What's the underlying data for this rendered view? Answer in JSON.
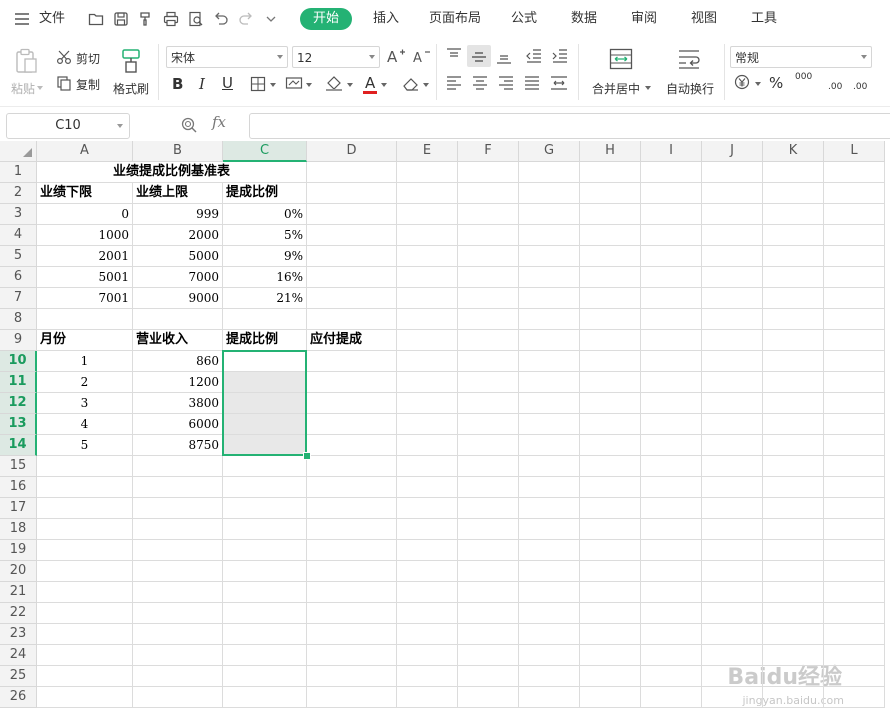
{
  "menu": {
    "hamburger_icon": "menu-icon",
    "file_label": "文件",
    "quick_icons": [
      "open-folder-icon",
      "save-icon",
      "format-painter-icon",
      "print-icon",
      "print-preview-icon",
      "undo-icon",
      "redo-icon",
      "more-dropdown-icon"
    ],
    "tabs": [
      {
        "label": "开始",
        "active": true
      },
      {
        "label": "插入",
        "active": false
      },
      {
        "label": "页面布局",
        "active": false
      },
      {
        "label": "公式",
        "active": false
      },
      {
        "label": "数据",
        "active": false
      },
      {
        "label": "审阅",
        "active": false
      },
      {
        "label": "视图",
        "active": false
      },
      {
        "label": "工具",
        "active": false
      }
    ],
    "accent_color": "#24b274"
  },
  "ribbon": {
    "paste_label": "粘贴",
    "cut_label": "剪切",
    "copy_label": "复制",
    "format_painter_label": "格式刷",
    "font_name": "宋体",
    "font_size": "12",
    "bold_label": "B",
    "italic_label": "I",
    "underline_label": "U",
    "font_color_letter": "A",
    "font_color": "#e02020",
    "merge_label": "合并居中",
    "wrap_label": "自动换行",
    "number_format": "常规",
    "percent_label": "%",
    "thousands_label": "000",
    "inc_decimal_label": ".00",
    "dec_decimal_label": ".00"
  },
  "formula_bar": {
    "name_box": "C10",
    "fx_label": "fx",
    "formula": ""
  },
  "sheet": {
    "columns": [
      "A",
      "B",
      "C",
      "D",
      "E",
      "F",
      "G",
      "H",
      "I",
      "J",
      "K",
      "L"
    ],
    "active_column": "C",
    "rows": [
      "1",
      "2",
      "3",
      "4",
      "5",
      "6",
      "7",
      "8",
      "9",
      "10",
      "11",
      "12",
      "13",
      "14",
      "15",
      "16",
      "17",
      "18",
      "19",
      "20",
      "21",
      "22",
      "23",
      "24",
      "25",
      "26"
    ],
    "active_rows": [
      "10",
      "11",
      "12",
      "13",
      "14"
    ],
    "title": "业绩提成比例基准表",
    "rate_header": [
      "业绩下限",
      "业绩上限",
      "提成比例"
    ],
    "rate_rows": [
      [
        "0",
        "999",
        "0%"
      ],
      [
        "1000",
        "2000",
        "5%"
      ],
      [
        "2001",
        "5000",
        "9%"
      ],
      [
        "5001",
        "7000",
        "16%"
      ],
      [
        "7001",
        "9000",
        "21%"
      ]
    ],
    "sales_header": [
      "月份",
      "营业收入",
      "提成比例",
      "应付提成"
    ],
    "sales_rows": [
      [
        "1",
        "860"
      ],
      [
        "2",
        "1200"
      ],
      [
        "3",
        "3800"
      ],
      [
        "4",
        "6000"
      ],
      [
        "5",
        "8750"
      ]
    ],
    "selection": "C10:C14"
  },
  "watermark": {
    "brand": "Baidu经验",
    "url": "jingyan.baidu.com"
  }
}
